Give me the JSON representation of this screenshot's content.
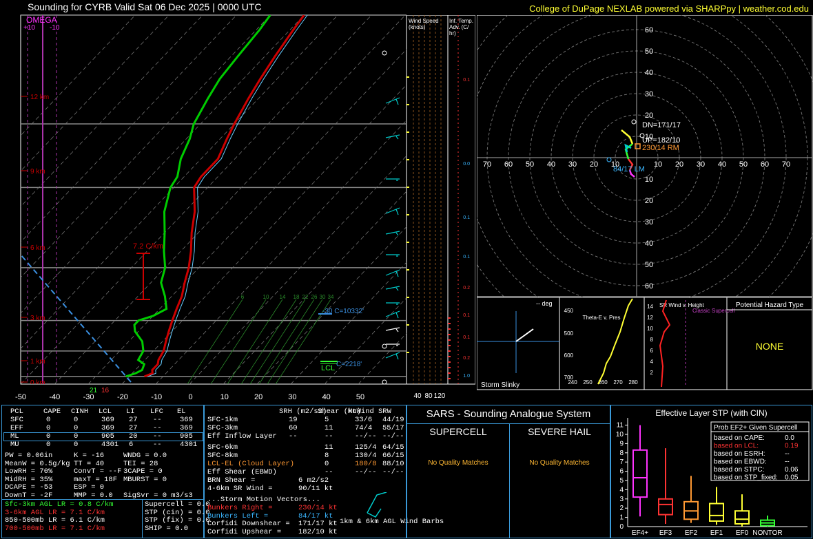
{
  "header": {
    "title": "Sounding for CYRB Valid  Sat 06 Dec 2025 | 0000 UTC",
    "credit": "College of DuPage NEXLAB powered via SHARPpy | weather.cod.edu"
  },
  "skewt": {
    "pressure_ticks": [
      "100",
      "200",
      "300",
      "500",
      "700",
      "850",
      "1000"
    ],
    "temp_ticks": [
      "-50",
      "-40",
      "-30",
      "-20",
      "-10",
      "0",
      "10",
      "20",
      "30",
      "40",
      "50"
    ],
    "height_labels": [
      "12 km",
      "9 km",
      "6 km",
      "3 km",
      "1 km",
      "0 km"
    ],
    "omega_label": "OMEGA",
    "omega_left": "+10",
    "omega_right": "-10",
    "lapse_label": "7.2 C/km",
    "mixing_ratios": [
      "6",
      "10",
      "14",
      "18",
      "22",
      "26",
      "30",
      "34"
    ],
    "el_label": "-30 C=10332'",
    "lcl_label": "LCL",
    "lcl_temp": "C=2218'",
    "sfc_t": "16",
    "sfc_td": "21"
  },
  "chart_data": [
    {
      "type": "line",
      "name": "skew-t",
      "temp": [
        [
          1000,
          -15.5
        ],
        [
          980,
          -14
        ],
        [
          960,
          -15
        ],
        [
          925,
          -15
        ],
        [
          900,
          -16
        ],
        [
          850,
          -17
        ],
        [
          800,
          -19
        ],
        [
          750,
          -21
        ],
        [
          700,
          -23
        ],
        [
          650,
          -25
        ],
        [
          600,
          -27
        ],
        [
          550,
          -30
        ],
        [
          500,
          -33
        ],
        [
          450,
          -37
        ],
        [
          400,
          -42
        ],
        [
          350,
          -47
        ],
        [
          300,
          -54
        ],
        [
          280,
          -55
        ],
        [
          250,
          -55
        ],
        [
          220,
          -58
        ],
        [
          200,
          -60
        ],
        [
          170,
          -63
        ],
        [
          150,
          -65
        ],
        [
          130,
          -67
        ],
        [
          110,
          -69
        ],
        [
          100,
          -70
        ]
      ],
      "dewpoint": [
        [
          1000,
          -21
        ],
        [
          980,
          -19
        ],
        [
          960,
          -18
        ],
        [
          925,
          -19
        ],
        [
          900,
          -22
        ],
        [
          850,
          -23
        ],
        [
          800,
          -26
        ],
        [
          750,
          -31
        ],
        [
          720,
          -33
        ],
        [
          700,
          -33
        ],
        [
          680,
          -30
        ],
        [
          650,
          -28
        ],
        [
          600,
          -32
        ],
        [
          550,
          -37
        ],
        [
          500,
          -40
        ],
        [
          450,
          -45
        ],
        [
          400,
          -50
        ],
        [
          350,
          -56
        ],
        [
          300,
          -61
        ],
        [
          280,
          -62
        ],
        [
          250,
          -66
        ],
        [
          220,
          -69
        ],
        [
          200,
          -72
        ],
        [
          170,
          -75
        ],
        [
          150,
          -77
        ],
        [
          130,
          -78
        ],
        [
          110,
          -79
        ],
        [
          100,
          -80
        ]
      ]
    },
    {
      "type": "scatter",
      "name": "hodograph",
      "points": [
        [
          2,
          -2
        ],
        [
          4,
          0
        ],
        [
          6,
          2
        ],
        [
          8,
          3
        ],
        [
          7,
          5
        ],
        [
          5,
          7
        ],
        [
          4,
          9
        ],
        [
          3,
          11
        ],
        [
          5,
          13
        ],
        [
          7,
          14
        ]
      ],
      "labels": {
        "dn": "DN=171/17",
        "up": "UP=182/10",
        "rm": "230/14 RM",
        "lm": "84/17 LM"
      },
      "rings": [
        "10",
        "20",
        "30",
        "40",
        "50",
        "60",
        "70"
      ]
    }
  ],
  "windspeed": {
    "title": "Wind Speed (knots)",
    "ticks": [
      "40",
      "80",
      "120"
    ]
  },
  "inftemp": {
    "title": "Inf. Temp. Adv. (C/ hr)",
    "values": [
      "0.1",
      "0.0",
      "0.1",
      "0.1",
      "0.2",
      "0.1",
      "0.1",
      "0.2",
      "1.0"
    ]
  },
  "slinky": {
    "deg": "-- deg",
    "label": "Storm Slinky"
  },
  "thetae": {
    "title": "Theta-E v. Pres",
    "yticks": [
      "500",
      "600",
      "700",
      "800",
      "900"
    ],
    "xticks": [
      "240",
      "250",
      "260",
      "270",
      "280"
    ],
    "top": "450"
  },
  "srwind": {
    "title": "SR Wind v. Height",
    "classic": "Classic Supercell",
    "yticks": [
      "14",
      "12",
      "10",
      "8",
      "6",
      "4",
      "2"
    ]
  },
  "hazard": {
    "title": "Potential Hazard Type",
    "value": "NONE"
  },
  "parcels": {
    "headers": [
      "PCL",
      "CAPE",
      "CINH",
      "LCL",
      "LI",
      "LFC",
      "EL"
    ],
    "rows": [
      [
        "SFC",
        "0",
        "0",
        "369",
        "27",
        "--",
        "369"
      ],
      [
        "EFF",
        "0",
        "0",
        "369",
        "27",
        "--",
        "369"
      ],
      [
        "ML",
        "0",
        "0",
        "905",
        "20",
        "--",
        "905"
      ],
      [
        "MU",
        "0",
        "0",
        "4301",
        "6",
        "--",
        "4301"
      ]
    ],
    "indices": [
      [
        "PW = 0.06in",
        "K = -16",
        "WNDG = 0.0"
      ],
      [
        "MeanW = 0.5g/kg",
        "TT = 40",
        "TEI = 28"
      ],
      [
        "LowRH = 70%",
        "ConvT = --F",
        "3CAPE = 0"
      ],
      [
        "MidRH = 35%",
        "maxT = 18F",
        "MBURST = 0"
      ],
      [
        "DCAPE = -53",
        "ESP = 0",
        ""
      ],
      [
        "DownT = -2F",
        "MMP = 0.0",
        "SigSvr = 0 m3/s3"
      ]
    ],
    "lapse": [
      [
        "Sfc-3km AGL LR = 0.8 C/km",
        "#33ff33"
      ],
      [
        "3-6km AGL LR = 7.1 C/km",
        "#ff3333"
      ],
      [
        "850-500mb LR = 6.1 C/km",
        "#ffffff"
      ],
      [
        "700-500mb LR = 7.1 C/km",
        "#ff3333"
      ]
    ],
    "composite": [
      "Supercell = 0.0",
      "STP (cin) = 0.0",
      "STP (fix) = 0.0",
      "SHIP = 0.0"
    ]
  },
  "kinematics": {
    "headers": [
      "SRH (m2/s2)",
      "Shear (kt)",
      "MnWind",
      "SRW"
    ],
    "rows": [
      [
        "SFC-1km",
        "19",
        "5",
        "33/6",
        "44/19"
      ],
      [
        "SFC-3km",
        "60",
        "11",
        "74/4",
        "55/17"
      ],
      [
        "Eff Inflow Layer",
        "--",
        "--",
        "--/--",
        "--/--"
      ]
    ],
    "rows2": [
      [
        "SFC-6km",
        "",
        "11",
        "125/4",
        "64/15"
      ],
      [
        "SFC-8km",
        "",
        "8",
        "130/4",
        "66/15"
      ],
      [
        "LCL-EL (Cloud Layer)",
        "",
        "0",
        "180/8",
        "88/10"
      ],
      [
        "Eff Shear (EBWD)",
        "",
        "--",
        "--/--",
        "--/--"
      ]
    ],
    "brn": [
      "BRN Shear =",
      "6 m2/s2"
    ],
    "srwind46": [
      "4-6km SR Wind =",
      "90/11 kt"
    ],
    "storm_title": "...Storm Motion Vectors...",
    "storm": [
      [
        "Bunkers Right =",
        "230/14 kt",
        "#ff3333"
      ],
      [
        "Bunkers Left =",
        "84/17 kt",
        "#3ab6ff"
      ],
      [
        "Corfidi Downshear =",
        "171/17 kt",
        "#ffffff"
      ],
      [
        "Corfidi Upshear =",
        "182/10 kt",
        "#ffffff"
      ]
    ],
    "barbs_label": "1km & 6km AGL Wind Barbs"
  },
  "sars": {
    "title": "SARS - Sounding Analogue System",
    "supercell": "SUPERCELL",
    "hail": "SEVERE HAIL",
    "nomatch": "No Quality Matches"
  },
  "stp": {
    "title": "Effective Layer STP (with CIN)",
    "yticks": [
      "0",
      "1",
      "2",
      "3",
      "4",
      "5",
      "6",
      "7",
      "8",
      "9",
      "10",
      "11"
    ],
    "cats": [
      "EF4+",
      "EF3",
      "EF2",
      "EF1",
      "EF0",
      "NONTOR"
    ],
    "boxes": [
      {
        "cat": "EF4+",
        "min": 1.1,
        "q1": 3.2,
        "med": 5.3,
        "q3": 8.3,
        "max": 11,
        "color": "#ff33ff"
      },
      {
        "cat": "EF3",
        "min": 0.3,
        "q1": 1.3,
        "med": 2.4,
        "q3": 3.0,
        "max": 8.5,
        "color": "#ff3333"
      },
      {
        "cat": "EF2",
        "min": 0.4,
        "q1": 0.8,
        "med": 1.7,
        "q3": 2.7,
        "max": 5.5,
        "color": "#ff9933"
      },
      {
        "cat": "EF1",
        "min": 0.2,
        "q1": 0.6,
        "med": 1.2,
        "q3": 2.5,
        "max": 4.3,
        "color": "#ffff33"
      },
      {
        "cat": "EF0",
        "min": 0.0,
        "q1": 0.3,
        "med": 0.8,
        "q3": 1.7,
        "max": 3.5,
        "color": "#ffff33"
      },
      {
        "cat": "NONTOR",
        "min": 0.0,
        "q1": 0.1,
        "med": 0.4,
        "q3": 0.7,
        "max": 1.2,
        "color": "#33ff33"
      }
    ],
    "prob_title": "Prob EF2+ Given Supercell",
    "prob": [
      [
        "based on CAPE:",
        "0.0",
        "#fff"
      ],
      [
        "based on LCL:",
        "0.19",
        "#ff3333"
      ],
      [
        "based on ESRH:",
        "--",
        "#fff"
      ],
      [
        "based on EBWD:",
        "--",
        "#fff"
      ],
      [
        "based on STPC:",
        "0.06",
        "#fff"
      ],
      [
        "based on STP_fixed:",
        "0.05",
        "#fff"
      ]
    ]
  },
  "colors": {
    "temp": "#cc0000",
    "dew": "#00cc00",
    "env": "#66ccff",
    "border": "#3a9ad9"
  }
}
